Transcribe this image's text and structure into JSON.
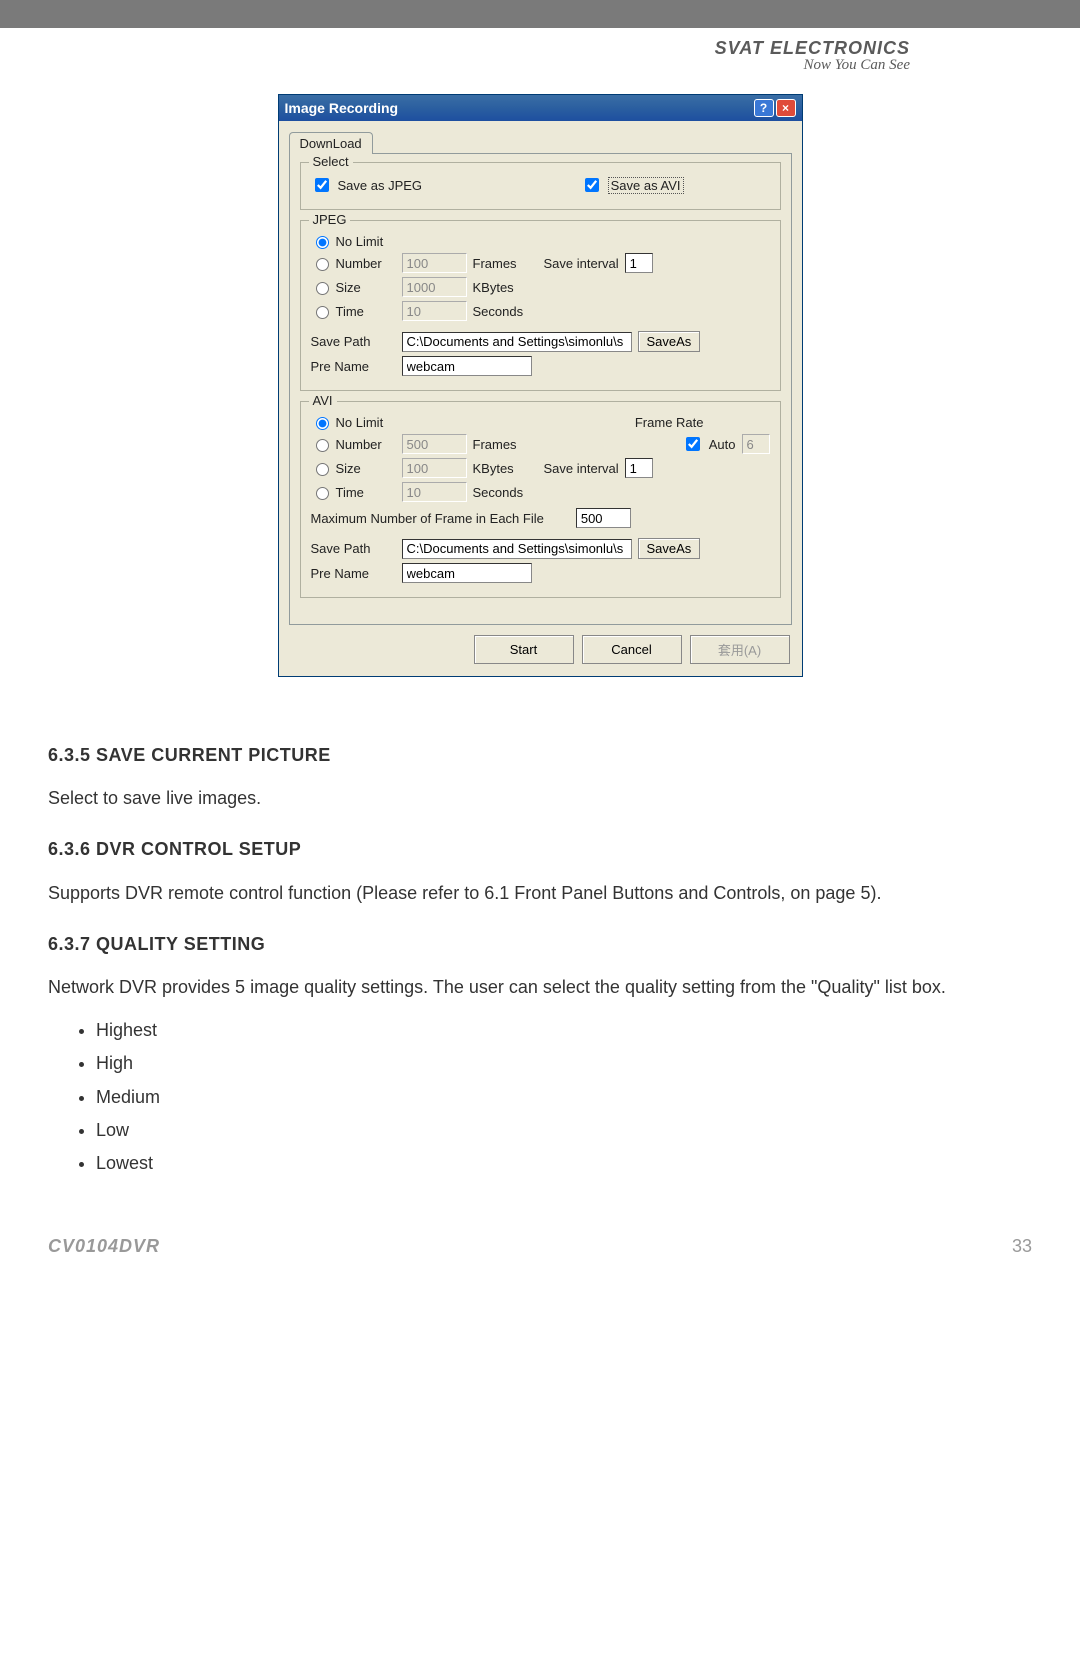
{
  "header": {
    "brand": "SVAT ELECTRONICS",
    "tagline": "Now You Can See"
  },
  "dialog": {
    "title": "Image Recording",
    "tab": "DownLoad",
    "select": {
      "legend": "Select",
      "save_jpeg": "Save as JPEG",
      "save_avi": "Save as AVI"
    },
    "jpeg": {
      "legend": "JPEG",
      "opts": {
        "nolimit": "No Limit",
        "number": "Number",
        "size": "Size",
        "time": "Time"
      },
      "number_val": "100",
      "number_unit": "Frames",
      "size_val": "1000",
      "size_unit": "KBytes",
      "time_val": "10",
      "time_unit": "Seconds",
      "save_interval_label": "Save interval",
      "save_interval_val": "1",
      "save_path_label": "Save Path",
      "save_path_val": "C:\\Documents and Settings\\simonlu\\s",
      "saveas_btn": "SaveAs",
      "prename_label": "Pre Name",
      "prename_val": "webcam"
    },
    "avi": {
      "legend": "AVI",
      "opts": {
        "nolimit": "No Limit",
        "number": "Number",
        "size": "Size",
        "time": "Time"
      },
      "number_val": "500",
      "number_unit": "Frames",
      "size_val": "100",
      "size_unit": "KBytes",
      "time_val": "10",
      "time_unit": "Seconds",
      "frame_rate_label": "Frame Rate",
      "auto_label": "Auto",
      "frame_rate_val": "6",
      "save_interval_label": "Save interval",
      "save_interval_val": "1",
      "max_frames_label": "Maximum Number of Frame in Each File",
      "max_frames_val": "500",
      "save_path_label": "Save Path",
      "save_path_val": "C:\\Documents and Settings\\simonlu\\s",
      "saveas_btn": "SaveAs",
      "prename_label": "Pre Name",
      "prename_val": "webcam"
    },
    "buttons": {
      "start": "Start",
      "cancel": "Cancel",
      "apply": "套用(A)"
    }
  },
  "doc": {
    "s635_title": "6.3.5 SAVE CURRENT PICTURE",
    "s635_body": "Select to save live images.",
    "s636_title": "6.3.6 DVR CONTROL SETUP",
    "s636_body": "Supports DVR remote control function (Please refer to 6.1 Front Panel Buttons and Controls, on page 5).",
    "s637_title": "6.3.7 QUALITY SETTING",
    "s637_body": "Network DVR provides 5 image quality settings. The user can select the quality setting from the \"Quality\" list box.",
    "quality_items": [
      "Highest",
      "High",
      "Medium",
      "Low",
      "Lowest"
    ]
  },
  "footer": {
    "model": "CV0104DVR",
    "page": "33"
  }
}
